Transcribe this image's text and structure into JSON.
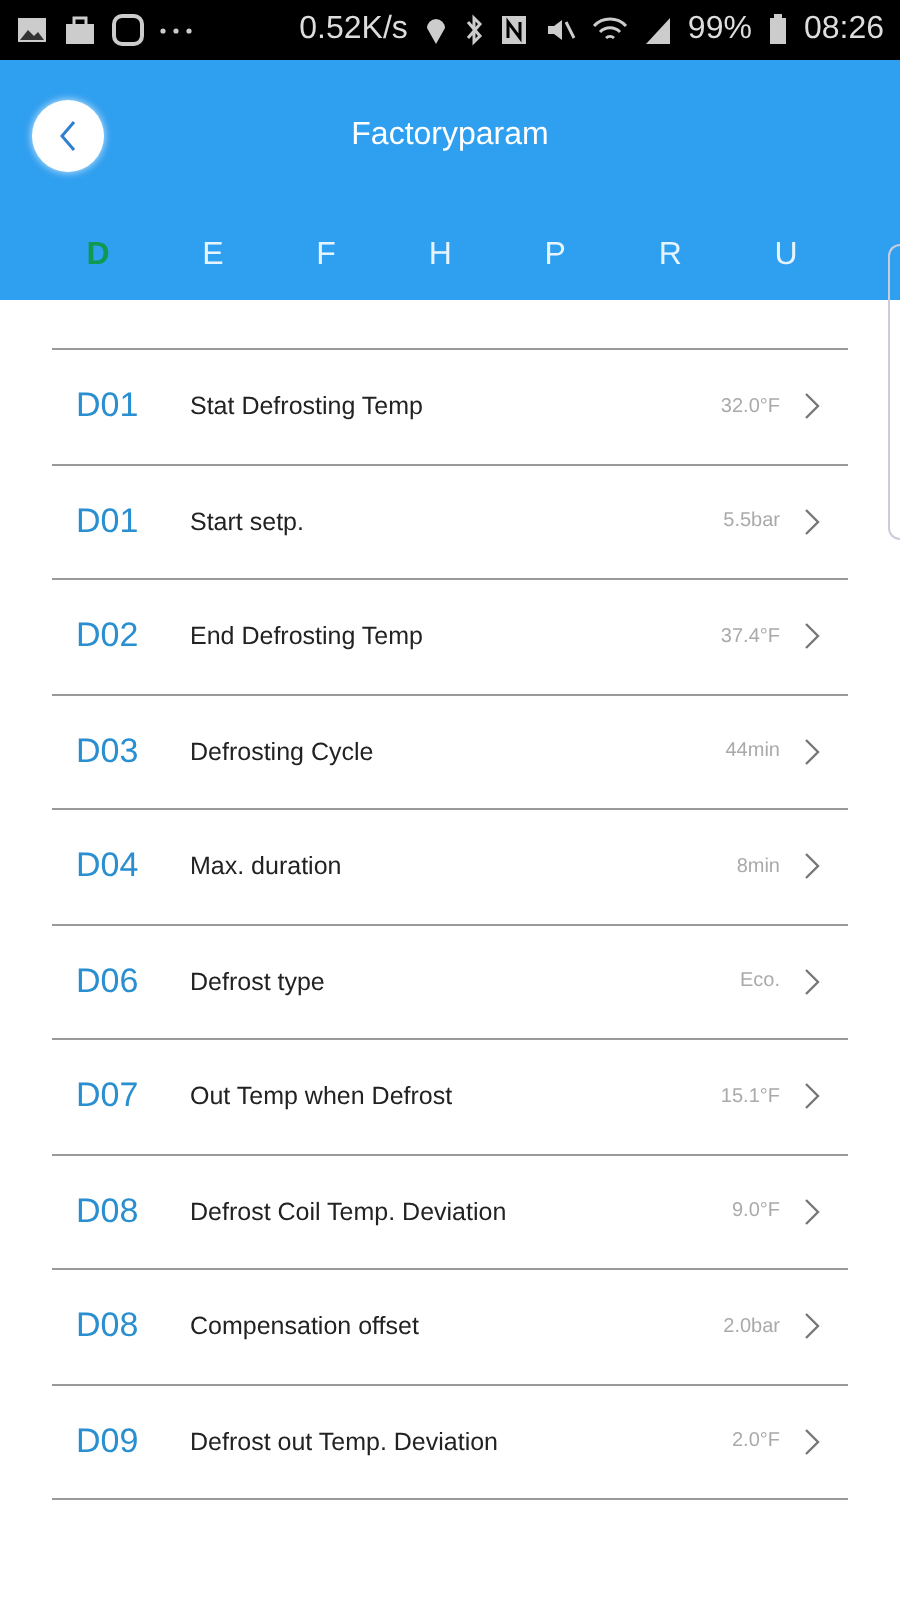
{
  "status_bar": {
    "speed": "0.52K/s",
    "battery": "99%",
    "time": "08:26"
  },
  "header": {
    "title": "Factoryparam"
  },
  "tabs": [
    {
      "label": "D",
      "selected": true
    },
    {
      "label": "E",
      "selected": false
    },
    {
      "label": "F",
      "selected": false
    },
    {
      "label": "H",
      "selected": false
    },
    {
      "label": "P",
      "selected": false
    },
    {
      "label": "R",
      "selected": false
    },
    {
      "label": "U",
      "selected": false
    }
  ],
  "params": [
    {
      "code": "D01",
      "name": "Stat Defrosting Temp",
      "value": "32.0°F"
    },
    {
      "code": "D01",
      "name": "Start setp.",
      "value": "5.5bar"
    },
    {
      "code": "D02",
      "name": "End Defrosting Temp",
      "value": "37.4°F"
    },
    {
      "code": "D03",
      "name": "Defrosting Cycle",
      "value": "44min"
    },
    {
      "code": "D04",
      "name": "Max. duration",
      "value": "8min"
    },
    {
      "code": "D06",
      "name": "Defrost type",
      "value": "Eco."
    },
    {
      "code": "D07",
      "name": "Out Temp when Defrost",
      "value": "15.1°F"
    },
    {
      "code": "D08",
      "name": "Defrost Coil Temp. Deviation",
      "value": "9.0°F"
    },
    {
      "code": "D08",
      "name": "Compensation offset",
      "value": "2.0bar"
    },
    {
      "code": "D09",
      "name": "Defrost out Temp. Deviation",
      "value": "2.0°F"
    }
  ]
}
